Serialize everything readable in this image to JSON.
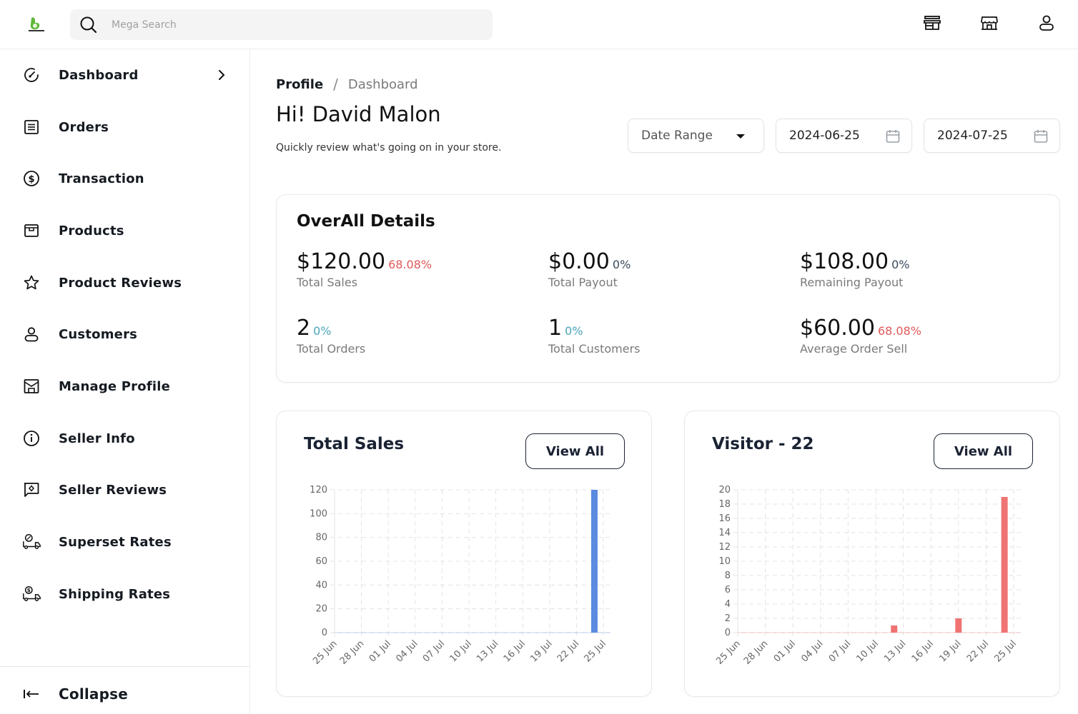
{
  "header": {
    "logo_alt": "store logo",
    "search_placeholder": "Mega Search",
    "icons": [
      "storefront-icon",
      "shop-icon",
      "user-icon"
    ]
  },
  "sidebar": {
    "items": [
      {
        "label": "Dashboard",
        "icon": "dashboard-gauge-icon",
        "has_chevron": true
      },
      {
        "label": "Orders",
        "icon": "orders-list-icon"
      },
      {
        "label": "Transaction",
        "icon": "dollar-circle-icon"
      },
      {
        "label": "Products",
        "icon": "product-box-icon"
      },
      {
        "label": "Product Reviews",
        "icon": "star-icon"
      },
      {
        "label": "Customers",
        "icon": "user-icon"
      },
      {
        "label": "Manage Profile",
        "icon": "profile-store-icon"
      },
      {
        "label": "Seller Info",
        "icon": "info-circle-icon"
      },
      {
        "label": "Seller Reviews",
        "icon": "review-chat-icon"
      },
      {
        "label": "Superset Rates",
        "icon": "truck-percent-icon"
      },
      {
        "label": "Shipping Rates",
        "icon": "truck-dollar-icon"
      }
    ],
    "collapse_label": "Collapse"
  },
  "breadcrumb": {
    "current": "Profile",
    "separator": "/",
    "link": "Dashboard"
  },
  "greeting": "Hi! David Malon",
  "subtext": "Quickly review what's going on in your store.",
  "filters": {
    "date_range_label": "Date Range",
    "start_date": "2024-06-25",
    "end_date": "2024-07-25"
  },
  "overall": {
    "title": "OverAll Details",
    "stats": [
      {
        "value": "$120.00",
        "percent": "68.08%",
        "percent_color": "#e05a5a",
        "label": "Total Sales"
      },
      {
        "value": "$0.00",
        "percent": "0%",
        "percent_color": "#3b4a5a",
        "label": "Total Payout"
      },
      {
        "value": "$108.00",
        "percent": "0%",
        "percent_color": "#3b4a5a",
        "label": "Remaining Payout"
      },
      {
        "value": "2",
        "percent": "0%",
        "percent_color": "#4aa6b8",
        "label": "Total Orders"
      },
      {
        "value": "1",
        "percent": "0%",
        "percent_color": "#4aa6b8",
        "label": "Total Customers"
      },
      {
        "value": "$60.00",
        "percent": "68.08%",
        "percent_color": "#e05a5a",
        "label": "Average Order Sell"
      }
    ]
  },
  "sales_card": {
    "title": "Total Sales",
    "button": "View All"
  },
  "visitor_card": {
    "title": "Visitor - 22",
    "button": "View All"
  },
  "chart_data": [
    {
      "type": "bar",
      "title": "Total Sales",
      "xlabel": "",
      "ylabel": "",
      "x_tick_labels": [
        "25 Jun",
        "28 Jun",
        "01 Jul",
        "04 Jul",
        "07 Jul",
        "10 Jul",
        "13 Jul",
        "16 Jul",
        "19 Jul",
        "22 Jul",
        "25 Jul"
      ],
      "x_range_days": [
        0,
        30
      ],
      "y_ticks": [
        0,
        20,
        40,
        60,
        80,
        100,
        120
      ],
      "ylim": [
        0,
        120
      ],
      "grid": true,
      "color": "#5b8be0",
      "series": [
        {
          "name": "Sales",
          "points": [
            {
              "x": "24 Jul",
              "day": 29,
              "value": 120
            }
          ]
        }
      ]
    },
    {
      "type": "bar",
      "title": "Visitor - 22",
      "xlabel": "",
      "ylabel": "",
      "x_tick_labels": [
        "25 Jun",
        "28 Jun",
        "01 Jul",
        "04 Jul",
        "07 Jul",
        "10 Jul",
        "13 Jul",
        "16 Jul",
        "19 Jul",
        "22 Jul",
        "25 Jul"
      ],
      "x_range_days": [
        0,
        30
      ],
      "y_ticks": [
        0,
        2,
        4,
        6,
        8,
        10,
        12,
        14,
        16,
        18,
        20
      ],
      "ylim": [
        0,
        20
      ],
      "grid": true,
      "color": "#f07373",
      "series": [
        {
          "name": "Visitors",
          "points": [
            {
              "x": "12 Jul",
              "day": 17,
              "value": 1
            },
            {
              "x": "19 Jul",
              "day": 24,
              "value": 2
            },
            {
              "x": "24 Jul",
              "day": 29,
              "value": 19
            }
          ]
        }
      ]
    }
  ]
}
